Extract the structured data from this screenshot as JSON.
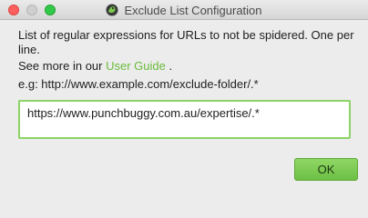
{
  "window": {
    "title": "Exclude List Configuration"
  },
  "content": {
    "description": "List of regular expressions for URLs to not be spidered. One per line.",
    "see_more_prefix": "See more in our ",
    "user_guide_link": "User Guide",
    "see_more_suffix": " .",
    "example": "e.g: http://www.example.com/exclude-folder/.*"
  },
  "exclude_input": {
    "value": "https://www.punchbuggy.com.au/expertise/.*"
  },
  "buttons": {
    "ok_label": "OK"
  },
  "colors": {
    "accent": "#6bbb3c",
    "input_border": "#8dd365",
    "ok_button": "#7cc94f"
  },
  "icons": {
    "app_icon": "frog-icon"
  }
}
